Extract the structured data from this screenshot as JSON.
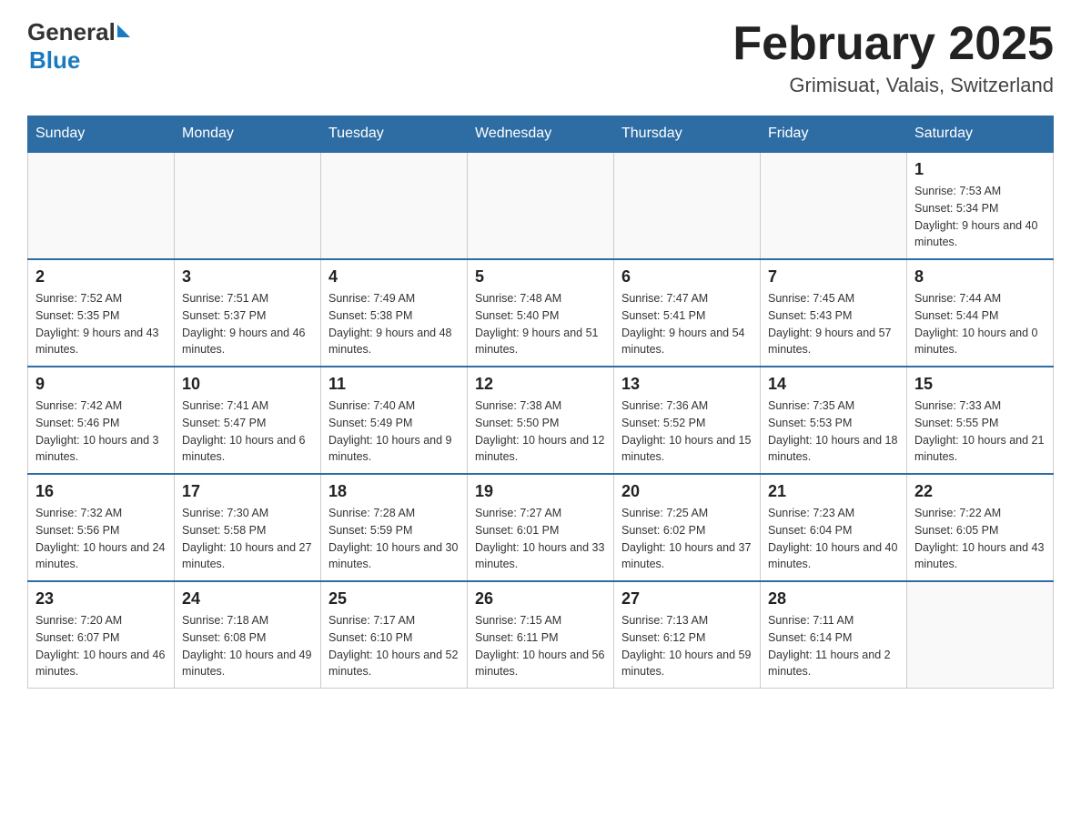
{
  "header": {
    "logo": {
      "general": "General",
      "triangle": "▶",
      "blue": "Blue"
    },
    "title": "February 2025",
    "subtitle": "Grimisuat, Valais, Switzerland"
  },
  "calendar": {
    "headers": [
      "Sunday",
      "Monday",
      "Tuesday",
      "Wednesday",
      "Thursday",
      "Friday",
      "Saturday"
    ],
    "weeks": [
      [
        {
          "day": "",
          "info": ""
        },
        {
          "day": "",
          "info": ""
        },
        {
          "day": "",
          "info": ""
        },
        {
          "day": "",
          "info": ""
        },
        {
          "day": "",
          "info": ""
        },
        {
          "day": "",
          "info": ""
        },
        {
          "day": "1",
          "info": "Sunrise: 7:53 AM\nSunset: 5:34 PM\nDaylight: 9 hours and 40 minutes."
        }
      ],
      [
        {
          "day": "2",
          "info": "Sunrise: 7:52 AM\nSunset: 5:35 PM\nDaylight: 9 hours and 43 minutes."
        },
        {
          "day": "3",
          "info": "Sunrise: 7:51 AM\nSunset: 5:37 PM\nDaylight: 9 hours and 46 minutes."
        },
        {
          "day": "4",
          "info": "Sunrise: 7:49 AM\nSunset: 5:38 PM\nDaylight: 9 hours and 48 minutes."
        },
        {
          "day": "5",
          "info": "Sunrise: 7:48 AM\nSunset: 5:40 PM\nDaylight: 9 hours and 51 minutes."
        },
        {
          "day": "6",
          "info": "Sunrise: 7:47 AM\nSunset: 5:41 PM\nDaylight: 9 hours and 54 minutes."
        },
        {
          "day": "7",
          "info": "Sunrise: 7:45 AM\nSunset: 5:43 PM\nDaylight: 9 hours and 57 minutes."
        },
        {
          "day": "8",
          "info": "Sunrise: 7:44 AM\nSunset: 5:44 PM\nDaylight: 10 hours and 0 minutes."
        }
      ],
      [
        {
          "day": "9",
          "info": "Sunrise: 7:42 AM\nSunset: 5:46 PM\nDaylight: 10 hours and 3 minutes."
        },
        {
          "day": "10",
          "info": "Sunrise: 7:41 AM\nSunset: 5:47 PM\nDaylight: 10 hours and 6 minutes."
        },
        {
          "day": "11",
          "info": "Sunrise: 7:40 AM\nSunset: 5:49 PM\nDaylight: 10 hours and 9 minutes."
        },
        {
          "day": "12",
          "info": "Sunrise: 7:38 AM\nSunset: 5:50 PM\nDaylight: 10 hours and 12 minutes."
        },
        {
          "day": "13",
          "info": "Sunrise: 7:36 AM\nSunset: 5:52 PM\nDaylight: 10 hours and 15 minutes."
        },
        {
          "day": "14",
          "info": "Sunrise: 7:35 AM\nSunset: 5:53 PM\nDaylight: 10 hours and 18 minutes."
        },
        {
          "day": "15",
          "info": "Sunrise: 7:33 AM\nSunset: 5:55 PM\nDaylight: 10 hours and 21 minutes."
        }
      ],
      [
        {
          "day": "16",
          "info": "Sunrise: 7:32 AM\nSunset: 5:56 PM\nDaylight: 10 hours and 24 minutes."
        },
        {
          "day": "17",
          "info": "Sunrise: 7:30 AM\nSunset: 5:58 PM\nDaylight: 10 hours and 27 minutes."
        },
        {
          "day": "18",
          "info": "Sunrise: 7:28 AM\nSunset: 5:59 PM\nDaylight: 10 hours and 30 minutes."
        },
        {
          "day": "19",
          "info": "Sunrise: 7:27 AM\nSunset: 6:01 PM\nDaylight: 10 hours and 33 minutes."
        },
        {
          "day": "20",
          "info": "Sunrise: 7:25 AM\nSunset: 6:02 PM\nDaylight: 10 hours and 37 minutes."
        },
        {
          "day": "21",
          "info": "Sunrise: 7:23 AM\nSunset: 6:04 PM\nDaylight: 10 hours and 40 minutes."
        },
        {
          "day": "22",
          "info": "Sunrise: 7:22 AM\nSunset: 6:05 PM\nDaylight: 10 hours and 43 minutes."
        }
      ],
      [
        {
          "day": "23",
          "info": "Sunrise: 7:20 AM\nSunset: 6:07 PM\nDaylight: 10 hours and 46 minutes."
        },
        {
          "day": "24",
          "info": "Sunrise: 7:18 AM\nSunset: 6:08 PM\nDaylight: 10 hours and 49 minutes."
        },
        {
          "day": "25",
          "info": "Sunrise: 7:17 AM\nSunset: 6:10 PM\nDaylight: 10 hours and 52 minutes."
        },
        {
          "day": "26",
          "info": "Sunrise: 7:15 AM\nSunset: 6:11 PM\nDaylight: 10 hours and 56 minutes."
        },
        {
          "day": "27",
          "info": "Sunrise: 7:13 AM\nSunset: 6:12 PM\nDaylight: 10 hours and 59 minutes."
        },
        {
          "day": "28",
          "info": "Sunrise: 7:11 AM\nSunset: 6:14 PM\nDaylight: 11 hours and 2 minutes."
        },
        {
          "day": "",
          "info": ""
        }
      ]
    ]
  }
}
